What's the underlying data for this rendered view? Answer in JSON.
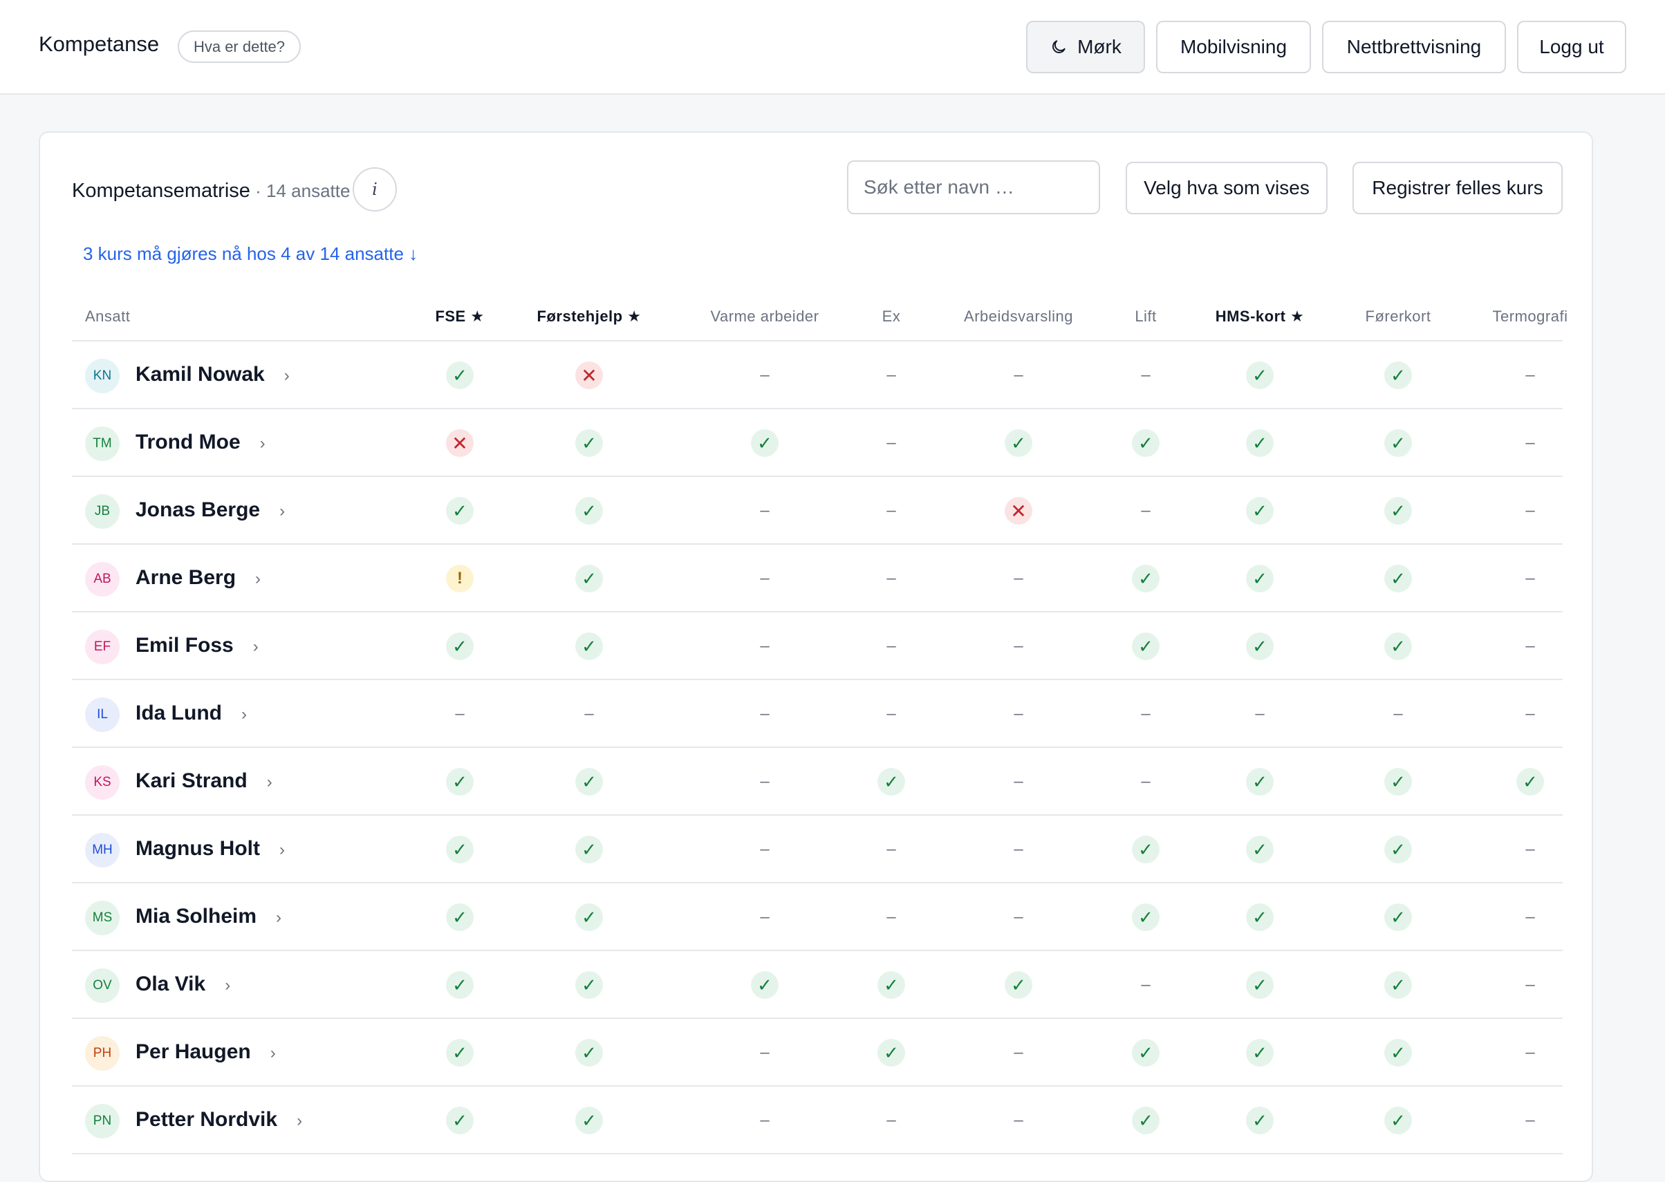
{
  "header": {
    "app_title": "Kompetanse",
    "help_label": "Hva er dette?",
    "buttons": {
      "dark_mode": "Mørk",
      "mobile_view": "Mobilvisning",
      "tablet_view": "Nettbrettvisning",
      "logout": "Logg ut"
    }
  },
  "matrix": {
    "title": "Kompetansematrise",
    "count_text": " · 14 ansatte",
    "info_icon": "i",
    "search_placeholder": "Søk etter navn …",
    "choose_columns_label": "Velg hva som vises",
    "register_course_label": "Registrer felles kurs",
    "alert_text": "3 kurs må gjøres nå hos 4 av 14 ansatte ↓",
    "employee_header": "Ansatt",
    "columns": [
      {
        "label": "FSE ★",
        "required": true
      },
      {
        "label": "Førstehjelp ★",
        "required": true
      },
      {
        "label": "Varme arbeider",
        "required": false
      },
      {
        "label": "Ex",
        "required": false
      },
      {
        "label": "Arbeidsvarsling",
        "required": false
      },
      {
        "label": "Lift",
        "required": false
      },
      {
        "label": "HMS-kort ★",
        "required": true
      },
      {
        "label": "Førerkort",
        "required": false
      },
      {
        "label": "Termografi",
        "required": false
      }
    ],
    "status_symbols": {
      "ok": "✓",
      "bad": "✕",
      "warn": "!",
      "none": "–"
    },
    "status_colors": {
      "ok": "#15803d",
      "bad": "#c0262d",
      "warn": "#a16207",
      "link": "#2563eb"
    },
    "chevron": "›",
    "employees": [
      {
        "initials": "KN",
        "name": "Kamil Nowak",
        "avatar_bg": "#e4f3f5",
        "avatar_fg": "#0e7490",
        "statuses": [
          "ok",
          "bad",
          "none",
          "none",
          "none",
          "none",
          "ok",
          "ok",
          "none"
        ]
      },
      {
        "initials": "TM",
        "name": "Trond Moe",
        "avatar_bg": "#e5f4ea",
        "avatar_fg": "#15803d",
        "statuses": [
          "bad",
          "ok",
          "ok",
          "none",
          "ok",
          "ok",
          "ok",
          "ok",
          "none"
        ]
      },
      {
        "initials": "JB",
        "name": "Jonas Berge",
        "avatar_bg": "#e5f4ea",
        "avatar_fg": "#15803d",
        "statuses": [
          "ok",
          "ok",
          "none",
          "none",
          "bad",
          "none",
          "ok",
          "ok",
          "none"
        ]
      },
      {
        "initials": "AB",
        "name": "Arne Berg",
        "avatar_bg": "#fce7f3",
        "avatar_fg": "#be185d",
        "statuses": [
          "warn",
          "ok",
          "none",
          "none",
          "none",
          "ok",
          "ok",
          "ok",
          "none"
        ]
      },
      {
        "initials": "EF",
        "name": "Emil Foss",
        "avatar_bg": "#fce7f3",
        "avatar_fg": "#be185d",
        "statuses": [
          "ok",
          "ok",
          "none",
          "none",
          "none",
          "ok",
          "ok",
          "ok",
          "none"
        ]
      },
      {
        "initials": "IL",
        "name": "Ida Lund",
        "avatar_bg": "#e8edfb",
        "avatar_fg": "#1d4ed8",
        "statuses": [
          "none",
          "none",
          "none",
          "none",
          "none",
          "none",
          "none",
          "none",
          "none"
        ]
      },
      {
        "initials": "KS",
        "name": "Kari Strand",
        "avatar_bg": "#fce7f3",
        "avatar_fg": "#be185d",
        "statuses": [
          "ok",
          "ok",
          "none",
          "ok",
          "none",
          "none",
          "ok",
          "ok",
          "ok"
        ]
      },
      {
        "initials": "MH",
        "name": "Magnus Holt",
        "avatar_bg": "#e8edfb",
        "avatar_fg": "#1d4ed8",
        "statuses": [
          "ok",
          "ok",
          "none",
          "none",
          "none",
          "ok",
          "ok",
          "ok",
          "none"
        ]
      },
      {
        "initials": "MS",
        "name": "Mia Solheim",
        "avatar_bg": "#e5f4ea",
        "avatar_fg": "#15803d",
        "statuses": [
          "ok",
          "ok",
          "none",
          "none",
          "none",
          "ok",
          "ok",
          "ok",
          "none"
        ]
      },
      {
        "initials": "OV",
        "name": "Ola Vik",
        "avatar_bg": "#e5f4ea",
        "avatar_fg": "#15803d",
        "statuses": [
          "ok",
          "ok",
          "ok",
          "ok",
          "ok",
          "none",
          "ok",
          "ok",
          "none"
        ]
      },
      {
        "initials": "PH",
        "name": "Per Haugen",
        "avatar_bg": "#fdf0dc",
        "avatar_fg": "#c2410c",
        "statuses": [
          "ok",
          "ok",
          "none",
          "ok",
          "none",
          "ok",
          "ok",
          "ok",
          "none"
        ]
      },
      {
        "initials": "PN",
        "name": "Petter Nordvik",
        "avatar_bg": "#e5f4ea",
        "avatar_fg": "#15803d",
        "statuses": [
          "ok",
          "ok",
          "none",
          "none",
          "none",
          "ok",
          "ok",
          "ok",
          "none"
        ]
      }
    ]
  }
}
